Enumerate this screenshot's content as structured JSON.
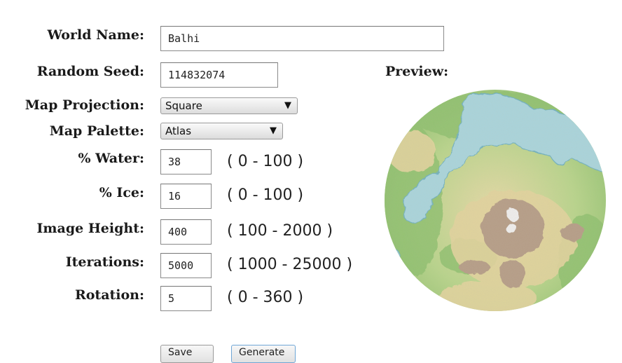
{
  "form": {
    "world_name": {
      "label": "World Name:",
      "value": "Balhi"
    },
    "random_seed": {
      "label": "Random Seed:",
      "value": "114832074"
    },
    "map_projection": {
      "label": "Map Projection:",
      "selected": "Square"
    },
    "map_palette": {
      "label": "Map Palette:",
      "selected": "Atlas"
    },
    "water": {
      "label": "% Water:",
      "value": "38",
      "range": "( 0 - 100 )"
    },
    "ice": {
      "label": "% Ice:",
      "value": "16",
      "range": "( 0 - 100 )"
    },
    "image_height": {
      "label": "Image Height:",
      "value": "400",
      "range": "( 100 - 2000 )"
    },
    "iterations": {
      "label": "Iterations:",
      "value": "5000",
      "range": "( 1000 - 25000 )"
    },
    "rotation": {
      "label": "Rotation:",
      "value": "5",
      "range": "( 0 - 360 )"
    }
  },
  "preview": {
    "label": "Preview:"
  },
  "buttons": {
    "save_label": "Save",
    "generate_label": "Generate"
  },
  "icons": {
    "dropdown": "triangle-down-icon"
  },
  "colors": {
    "ocean": "#a9d4dc",
    "lowland": "#8fc06e",
    "highland": "#e7d9a6",
    "mountain": "#b59c86",
    "peak": "#f0eeee"
  }
}
